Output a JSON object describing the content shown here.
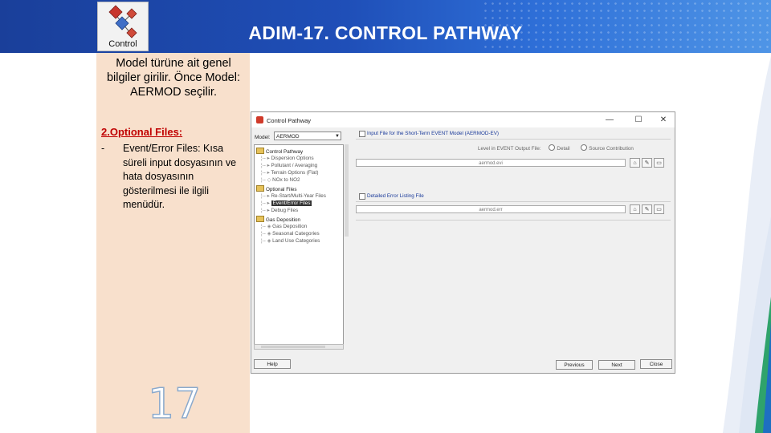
{
  "header": {
    "title": "ADIM-17. CONTROL PATHWAY",
    "logo_caption": "Control"
  },
  "left_panel": {
    "intro": "Model türüne ait genel bilgiler girilir. Önce Model: AERMOD seçilir.",
    "optional_title": "2.Optional Files:",
    "bullet_dash": "-",
    "optional_text": "Event/Error Files: Kısa süreli input dosyasının ve hata dosyasının gösterilmesi ile ilgili menüdür.",
    "page_number": "17"
  },
  "dialog": {
    "title": "Control Pathway",
    "minimize": "—",
    "maximize": "☐",
    "close": "✕",
    "model_label": "Model:",
    "model_value": "AERMOD",
    "tree": {
      "control_pathway": "Control Pathway",
      "dispersion_options": "Dispersion Options",
      "pollutant_averaging": "Pollutant / Averaging",
      "terrain_options": "Terrain Options (Flat)",
      "nox_to_no2": "NOx to NO2",
      "optional_files": "Optional Files",
      "restart_files": "Re-Start/Multi-Year Files",
      "event_error_files": "Event/Error Files",
      "debug_files": "Debug Files",
      "gas_deposition": "Gas Deposition",
      "gas_deposition_child1": "Gas Deposition",
      "gas_deposition_child2": "Seasonal Categories",
      "gas_deposition_child3": "Land Use Categories"
    },
    "right": {
      "input_file_label": "Input File for the Short-Term EVENT Model (AERMOD-EV)",
      "level_label": "Level in EVENT Output File:",
      "radio_detail": "Detail",
      "radio_source": "Source Contribution",
      "event_path": "aermod.evi",
      "error_label": "Detailed Error Listing File",
      "error_path": "aermod.err"
    },
    "buttons": {
      "help": "Help",
      "previous": "Previous",
      "next": "Next",
      "close": "Close"
    }
  },
  "colors": {
    "header_start": "#1a3f9a",
    "header_end": "#4f95e6",
    "panel_bg": "#f8e0cc",
    "optional_title": "#c00000"
  }
}
